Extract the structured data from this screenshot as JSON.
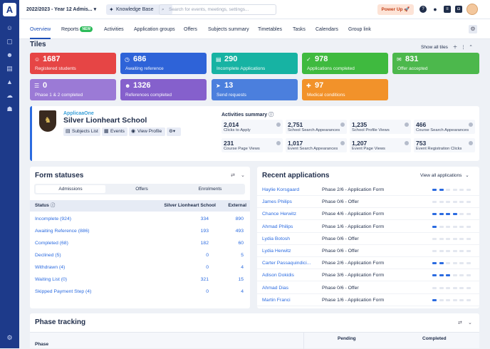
{
  "app": {
    "logo": "A",
    "context": "2022/2023 - Year 12 Admis...",
    "knowledge_base": "Knowledge Base",
    "search_placeholder": "Search for events, meetings, settings...",
    "power_up": "Power Up"
  },
  "tabs": [
    {
      "label": "Overview",
      "active": true
    },
    {
      "label": "Reports",
      "badge": "NEW"
    },
    {
      "label": "Activities"
    },
    {
      "label": "Application groups"
    },
    {
      "label": "Offers"
    },
    {
      "label": "Subjects summary"
    },
    {
      "label": "Timetables"
    },
    {
      "label": "Tasks"
    },
    {
      "label": "Calendars"
    },
    {
      "label": "Group link"
    }
  ],
  "tiles_section": {
    "title": "Tiles",
    "show_all": "Show all tiles"
  },
  "tiles": [
    {
      "value": "1687",
      "label": "Registered students",
      "color": "#e64545"
    },
    {
      "value": "686",
      "label": "Awaiting reference",
      "color": "#2e63d8"
    },
    {
      "value": "290",
      "label": "Incomplete Applications",
      "color": "#17b3a3"
    },
    {
      "value": "978",
      "label": "Applications completed",
      "color": "#3fba3f"
    },
    {
      "value": "831",
      "label": "Offer accepted",
      "color": "#4cb84c"
    },
    {
      "value": "0",
      "label": "Phase 1 & 2 completed",
      "color": "#9b7ad6"
    },
    {
      "value": "1326",
      "label": "References completed",
      "color": "#8560cc"
    },
    {
      "value": "13",
      "label": "Send requests",
      "color": "#4b7fdd"
    },
    {
      "value": "97",
      "label": "Medical conditions",
      "color": "#f2922a"
    }
  ],
  "school": {
    "brand": "ApplicaaOne",
    "name": "Silver Lionheart School",
    "buttons": [
      "Subjects List",
      "Events",
      "View Profile"
    ],
    "activities_title": "Activities summary",
    "stats": [
      {
        "value": "2,014",
        "label": "Clicks to Apply"
      },
      {
        "value": "2,751",
        "label": "School Search Appearances"
      },
      {
        "value": "1,235",
        "label": "School Profile Views"
      },
      {
        "value": "466",
        "label": "Course Search Appearances"
      },
      {
        "value": "231",
        "label": "Course Page Views"
      },
      {
        "value": "1,017",
        "label": "Event Search Appearances"
      },
      {
        "value": "1,207",
        "label": "Event Page Views"
      },
      {
        "value": "753",
        "label": "Event Registration Clicks"
      }
    ]
  },
  "form_statuses": {
    "title": "Form statuses",
    "segments": [
      "Admissions",
      "Offers",
      "Enrolments"
    ],
    "headers": [
      "Status",
      "Silver Lionheart School",
      "External"
    ],
    "rows": [
      {
        "name": "Incomplete (924)",
        "school": "334",
        "external": "890"
      },
      {
        "name": "Awaiting Reference (886)",
        "school": "193",
        "external": "493"
      },
      {
        "name": "Completed (68)",
        "school": "182",
        "external": "60"
      },
      {
        "name": "Declined (5)",
        "school": "0",
        "external": "5"
      },
      {
        "name": "Withdrawn (4)",
        "school": "0",
        "external": "4"
      },
      {
        "name": "Waiting List (0)",
        "school": "321",
        "external": "15"
      },
      {
        "name": "Skipped Payment Step (4)",
        "school": "0",
        "external": "4"
      }
    ]
  },
  "recent_applications": {
    "title": "Recent applications",
    "view_all": "View all applications",
    "rows": [
      {
        "name": "Haylie Korsgaard",
        "phase": "Phase 2/6 - Application Form",
        "progress": 2
      },
      {
        "name": "James Philips",
        "phase": "Phase 0/6 - Offer",
        "progress": 0
      },
      {
        "name": "Chance Herwitz",
        "phase": "Phase 4/6 - Application Form",
        "progress": 4
      },
      {
        "name": "Ahmad Philips",
        "phase": "Phase 1/6 - Application Form",
        "progress": 1
      },
      {
        "name": "Lydia Botosh",
        "phase": "Phase 0/6 - Offer",
        "progress": 0
      },
      {
        "name": "Lydia Herwitz",
        "phase": "Phase 0/6 - Offer",
        "progress": 0
      },
      {
        "name": "Carter Passaquindici...",
        "phase": "Phase 2/6 - Application Form",
        "progress": 2
      },
      {
        "name": "Adison Dokidis",
        "phase": "Phase 3/6 - Application Form",
        "progress": 3
      },
      {
        "name": "Ahmad Dias",
        "phase": "Phase 0/6 - Offer",
        "progress": 0
      },
      {
        "name": "Martin Franci",
        "phase": "Phase 1/6 - Application Form",
        "progress": 1
      }
    ]
  },
  "phase_tracking": {
    "title": "Phase tracking",
    "col_phase": "Phase",
    "col_pending": "Pending",
    "col_completed": "Completed"
  }
}
